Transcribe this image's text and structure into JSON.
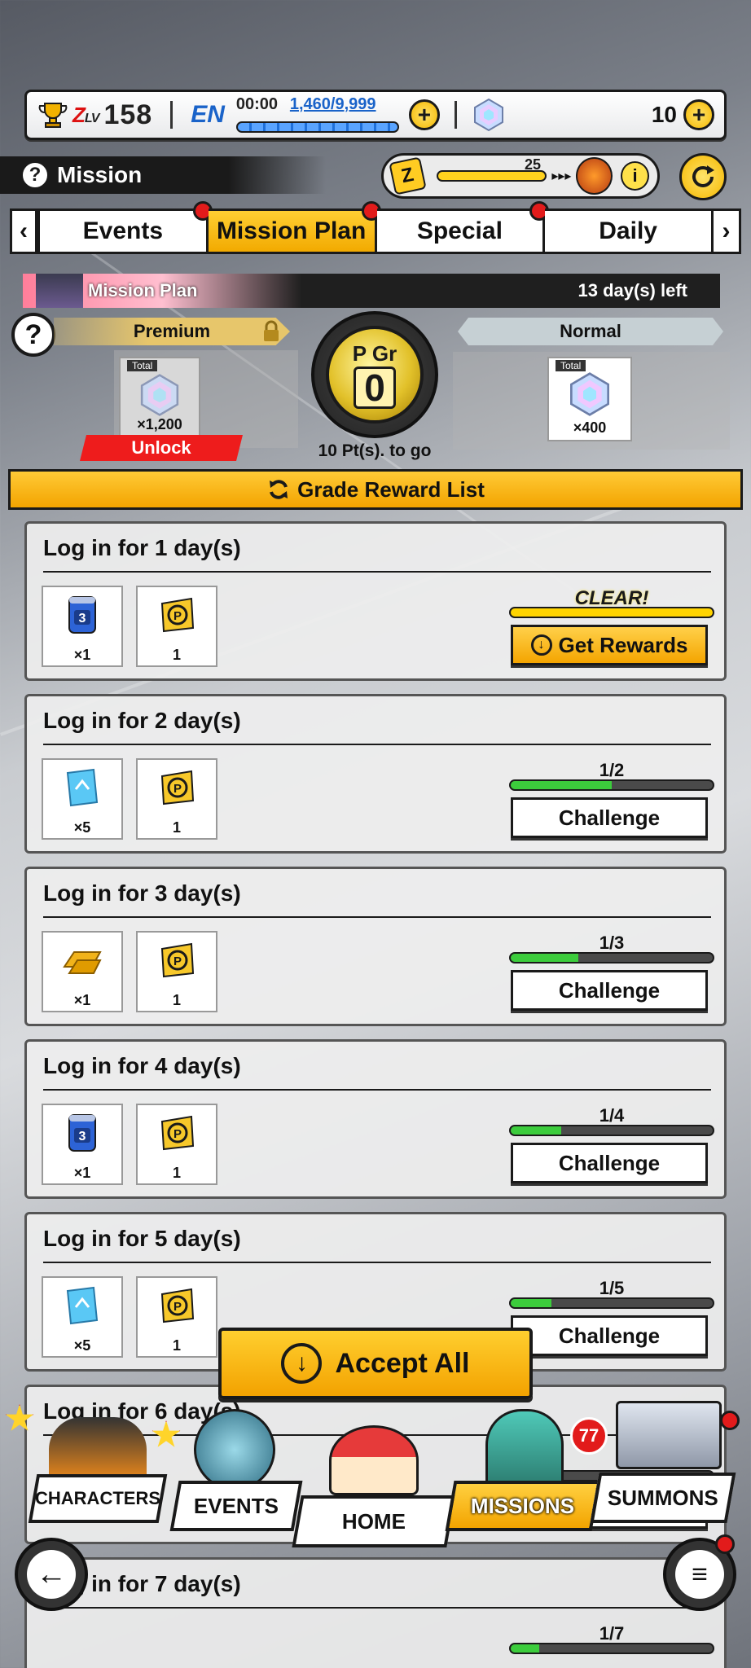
{
  "topbar": {
    "zlv_label": "Z",
    "zlv_suffix": "LV",
    "level": "158",
    "region": "EN",
    "stamina_timer": "00:00",
    "stamina_value": "1,460/9,999",
    "gems": "10"
  },
  "header": {
    "title": "Mission",
    "z_counter": "25"
  },
  "tabs": [
    {
      "label": "Events",
      "active": false,
      "dot": true
    },
    {
      "label": "Mission Plan",
      "active": true,
      "dot": true
    },
    {
      "label": "Special",
      "active": false,
      "dot": true
    },
    {
      "label": "Daily",
      "active": false,
      "dot": false
    }
  ],
  "plan": {
    "banner_label": "Mission Plan",
    "days_left": "13 day(s) left",
    "premium_label": "Premium",
    "normal_label": "Normal",
    "premium_total_tag": "Total",
    "premium_amount": "×1,200",
    "normal_total_tag": "Total",
    "normal_amount": "×400",
    "unlock_label": "Unlock",
    "grade_label": "P Gr",
    "grade_value": "0",
    "pts_to_go": "10 Pt(s). to go",
    "grade_reward_list": "Grade Reward List"
  },
  "missions": [
    {
      "title": "Log in for 1 day(s)",
      "items": [
        {
          "icon": "blue-can-3",
          "qty": "×1"
        },
        {
          "icon": "p-ticket",
          "qty": "1"
        }
      ],
      "progress_text": "CLEAR!",
      "progress": 1.0,
      "clear": true,
      "button": "Get Rewards"
    },
    {
      "title": "Log in for 2 day(s)",
      "items": [
        {
          "icon": "blue-ticket",
          "qty": "×5"
        },
        {
          "icon": "p-ticket",
          "qty": "1"
        }
      ],
      "progress_text": "1/2",
      "progress": 0.5,
      "clear": false,
      "button": "Challenge"
    },
    {
      "title": "Log in for 3 day(s)",
      "items": [
        {
          "icon": "gold-bar",
          "qty": "×1"
        },
        {
          "icon": "p-ticket",
          "qty": "1"
        }
      ],
      "progress_text": "1/3",
      "progress": 0.333,
      "clear": false,
      "button": "Challenge"
    },
    {
      "title": "Log in for 4 day(s)",
      "items": [
        {
          "icon": "blue-can-3",
          "qty": "×1"
        },
        {
          "icon": "p-ticket",
          "qty": "1"
        }
      ],
      "progress_text": "1/4",
      "progress": 0.25,
      "clear": false,
      "button": "Challenge"
    },
    {
      "title": "Log in for 5 day(s)",
      "items": [
        {
          "icon": "blue-ticket",
          "qty": "×5"
        },
        {
          "icon": "p-ticket",
          "qty": "1"
        }
      ],
      "progress_text": "1/5",
      "progress": 0.2,
      "clear": false,
      "button": "Challenge"
    },
    {
      "title": "Log in for 6 day(s)",
      "items": [],
      "progress_text": "",
      "progress": 0,
      "clear": false,
      "button": "Challenge"
    },
    {
      "title": "Log in for 7 day(s)",
      "items": [],
      "progress_text": "1/7",
      "progress": 0.143,
      "clear": false,
      "button": ""
    }
  ],
  "accept_all": "Accept All",
  "nav": {
    "characters": "CHARACTERS",
    "events": "EVENTS",
    "home": "HOME",
    "missions": "MISSIONS",
    "summons": "SUMMONS",
    "missions_badge": "77"
  }
}
